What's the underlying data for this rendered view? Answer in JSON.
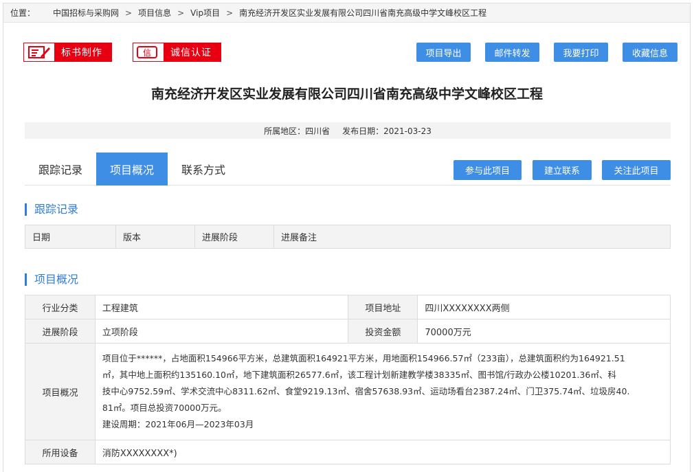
{
  "breadcrumb": {
    "lead": "位置：",
    "items": [
      "中国招标与采购网",
      "项目信息",
      "Vip项目",
      "南充经济开发区实业发展有限公司四川省南充高级中学文峰校区工程"
    ],
    "separator": ">"
  },
  "brand_buttons": [
    {
      "label": "标书制作",
      "icon": "document-pen-icon"
    },
    {
      "label": "诚信认证",
      "icon": "credit-seal-icon",
      "icon_text": "信"
    }
  ],
  "toolbar": [
    "项目导出",
    "邮件转发",
    "我要打印",
    "收藏信息"
  ],
  "title": "南充经济开发区实业发展有限公司四川省南充高级中学文峰校区工程",
  "meta": {
    "region": "所属地区：四川省",
    "date": "发布日期：2021-03-23"
  },
  "tabs": [
    {
      "label": "跟踪记录",
      "active": false
    },
    {
      "label": "项目概况",
      "active": true
    },
    {
      "label": "联系方式",
      "active": false
    }
  ],
  "actions": [
    "参与此项目",
    "建立联系",
    "关注此项目"
  ],
  "tracking": {
    "title": "跟踪记录",
    "columns": [
      "日期",
      "版本",
      "进展阶段",
      "进展备注"
    ]
  },
  "overview": {
    "title": "项目概况",
    "industry_label": "行业分类",
    "industry": "工程建筑",
    "address_label": "项目地址",
    "address": "四川XXXXXXXX两侧",
    "stage_label": "进展阶段",
    "stage": "立项阶段",
    "investment_label": "投资金额",
    "investment": "70000万元",
    "summary_label": "项目概况",
    "summary_lines": [
      "项目位于******，占地面积154966平方米，总建筑面积164921平方米，用地面积154966.57㎡（233亩），总建筑面积约为164921.51",
      "㎡，其中地上面积约135160.10㎡，地下建筑面积26577.6㎡，该工程计划新建教学楼38335㎡、图书馆/行政办公楼10201.36㎡、科",
      "技中心9752.59㎡、学术交流中心8311.62㎡、食堂9219.13㎡、宿舍57638.93㎡、运动场看台2387.24㎡、门卫375.74㎡、垃圾房40.",
      "81㎡。项目总投资70000万元。",
      "建设周期：2021年06月—2023年03月"
    ],
    "equipment_label": "所用设备",
    "equipment": "消防XXXXXXXX*)"
  },
  "colors": {
    "accent": "#3e8ee6",
    "brand_red": "#e60012",
    "section_blue": "#2f7dd6"
  }
}
